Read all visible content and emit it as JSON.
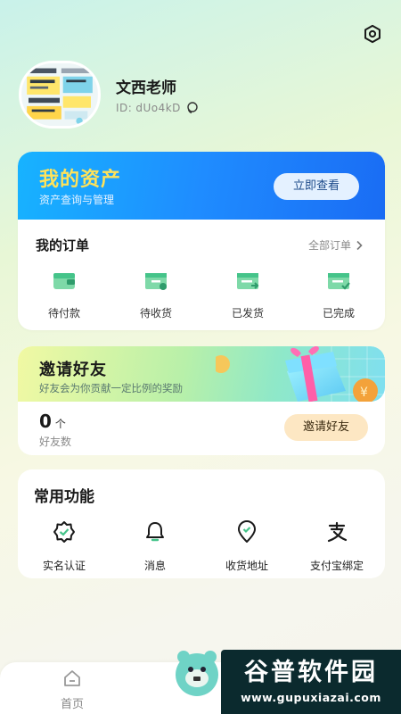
{
  "profile": {
    "name": "文西老师",
    "id_label": "ID:",
    "id_value": "dUo4kD"
  },
  "assets": {
    "title": "我的资产",
    "subtitle": "资产查询与管理",
    "button": "立即查看"
  },
  "orders": {
    "title": "我的订单",
    "all_label": "全部订单",
    "items": [
      {
        "label": "待付款",
        "icon": "wallet-icon"
      },
      {
        "label": "待收货",
        "icon": "receive-icon"
      },
      {
        "label": "已发货",
        "icon": "shipped-icon"
      },
      {
        "label": "已完成",
        "icon": "completed-icon"
      }
    ]
  },
  "invite": {
    "title": "邀请好友",
    "subtitle": "好友会为你贡献一定比例的奖励",
    "count": "0",
    "count_unit": "个",
    "count_label": "好友数",
    "button": "邀请好友"
  },
  "functions": {
    "title": "常用功能",
    "items": [
      {
        "label": "实名认证",
        "icon": "verified-badge-icon"
      },
      {
        "label": "消息",
        "icon": "bell-icon"
      },
      {
        "label": "收货地址",
        "icon": "location-pin-icon"
      },
      {
        "label": "支付宝绑定",
        "icon": "alipay-icon"
      }
    ]
  },
  "nav": {
    "home": "首页"
  },
  "watermark": {
    "top": "谷普软件园",
    "bottom": "www.gupuxiazai.com"
  },
  "colors": {
    "assets_gradient": "#1f8cff",
    "assets_title": "#ffe25a",
    "icon_green": "#45c48a",
    "invite_button": "#fde7c3"
  }
}
